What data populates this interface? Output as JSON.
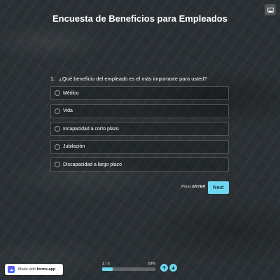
{
  "survey": {
    "title": "Encuesta de Beneficios para Empleados"
  },
  "question": {
    "number": "1.",
    "text": "¿Qué beneficio del empleado es el más importante para usted?",
    "options": [
      {
        "label": "Médico"
      },
      {
        "label": "Vida"
      },
      {
        "label": "Incapacidad a corto plazo"
      },
      {
        "label": "Jubilación"
      },
      {
        "label": "Discapacidad a largo plazo"
      }
    ]
  },
  "navigation": {
    "press_text": "Press",
    "press_key": "ENTER",
    "next_label": "Next"
  },
  "progress": {
    "step_text": "1 / 5",
    "percent_text": "20%",
    "fraction": 0.2
  },
  "branding": {
    "made_with": "Made with",
    "brand": "forms.app"
  },
  "colors": {
    "accent": "#6ed6ee",
    "background": "#2a3034"
  },
  "icons": {
    "top_right": "image-icon",
    "up": "arrow-up-icon",
    "down": "arrow-down-icon",
    "logo": "forms-app-logo-icon"
  }
}
